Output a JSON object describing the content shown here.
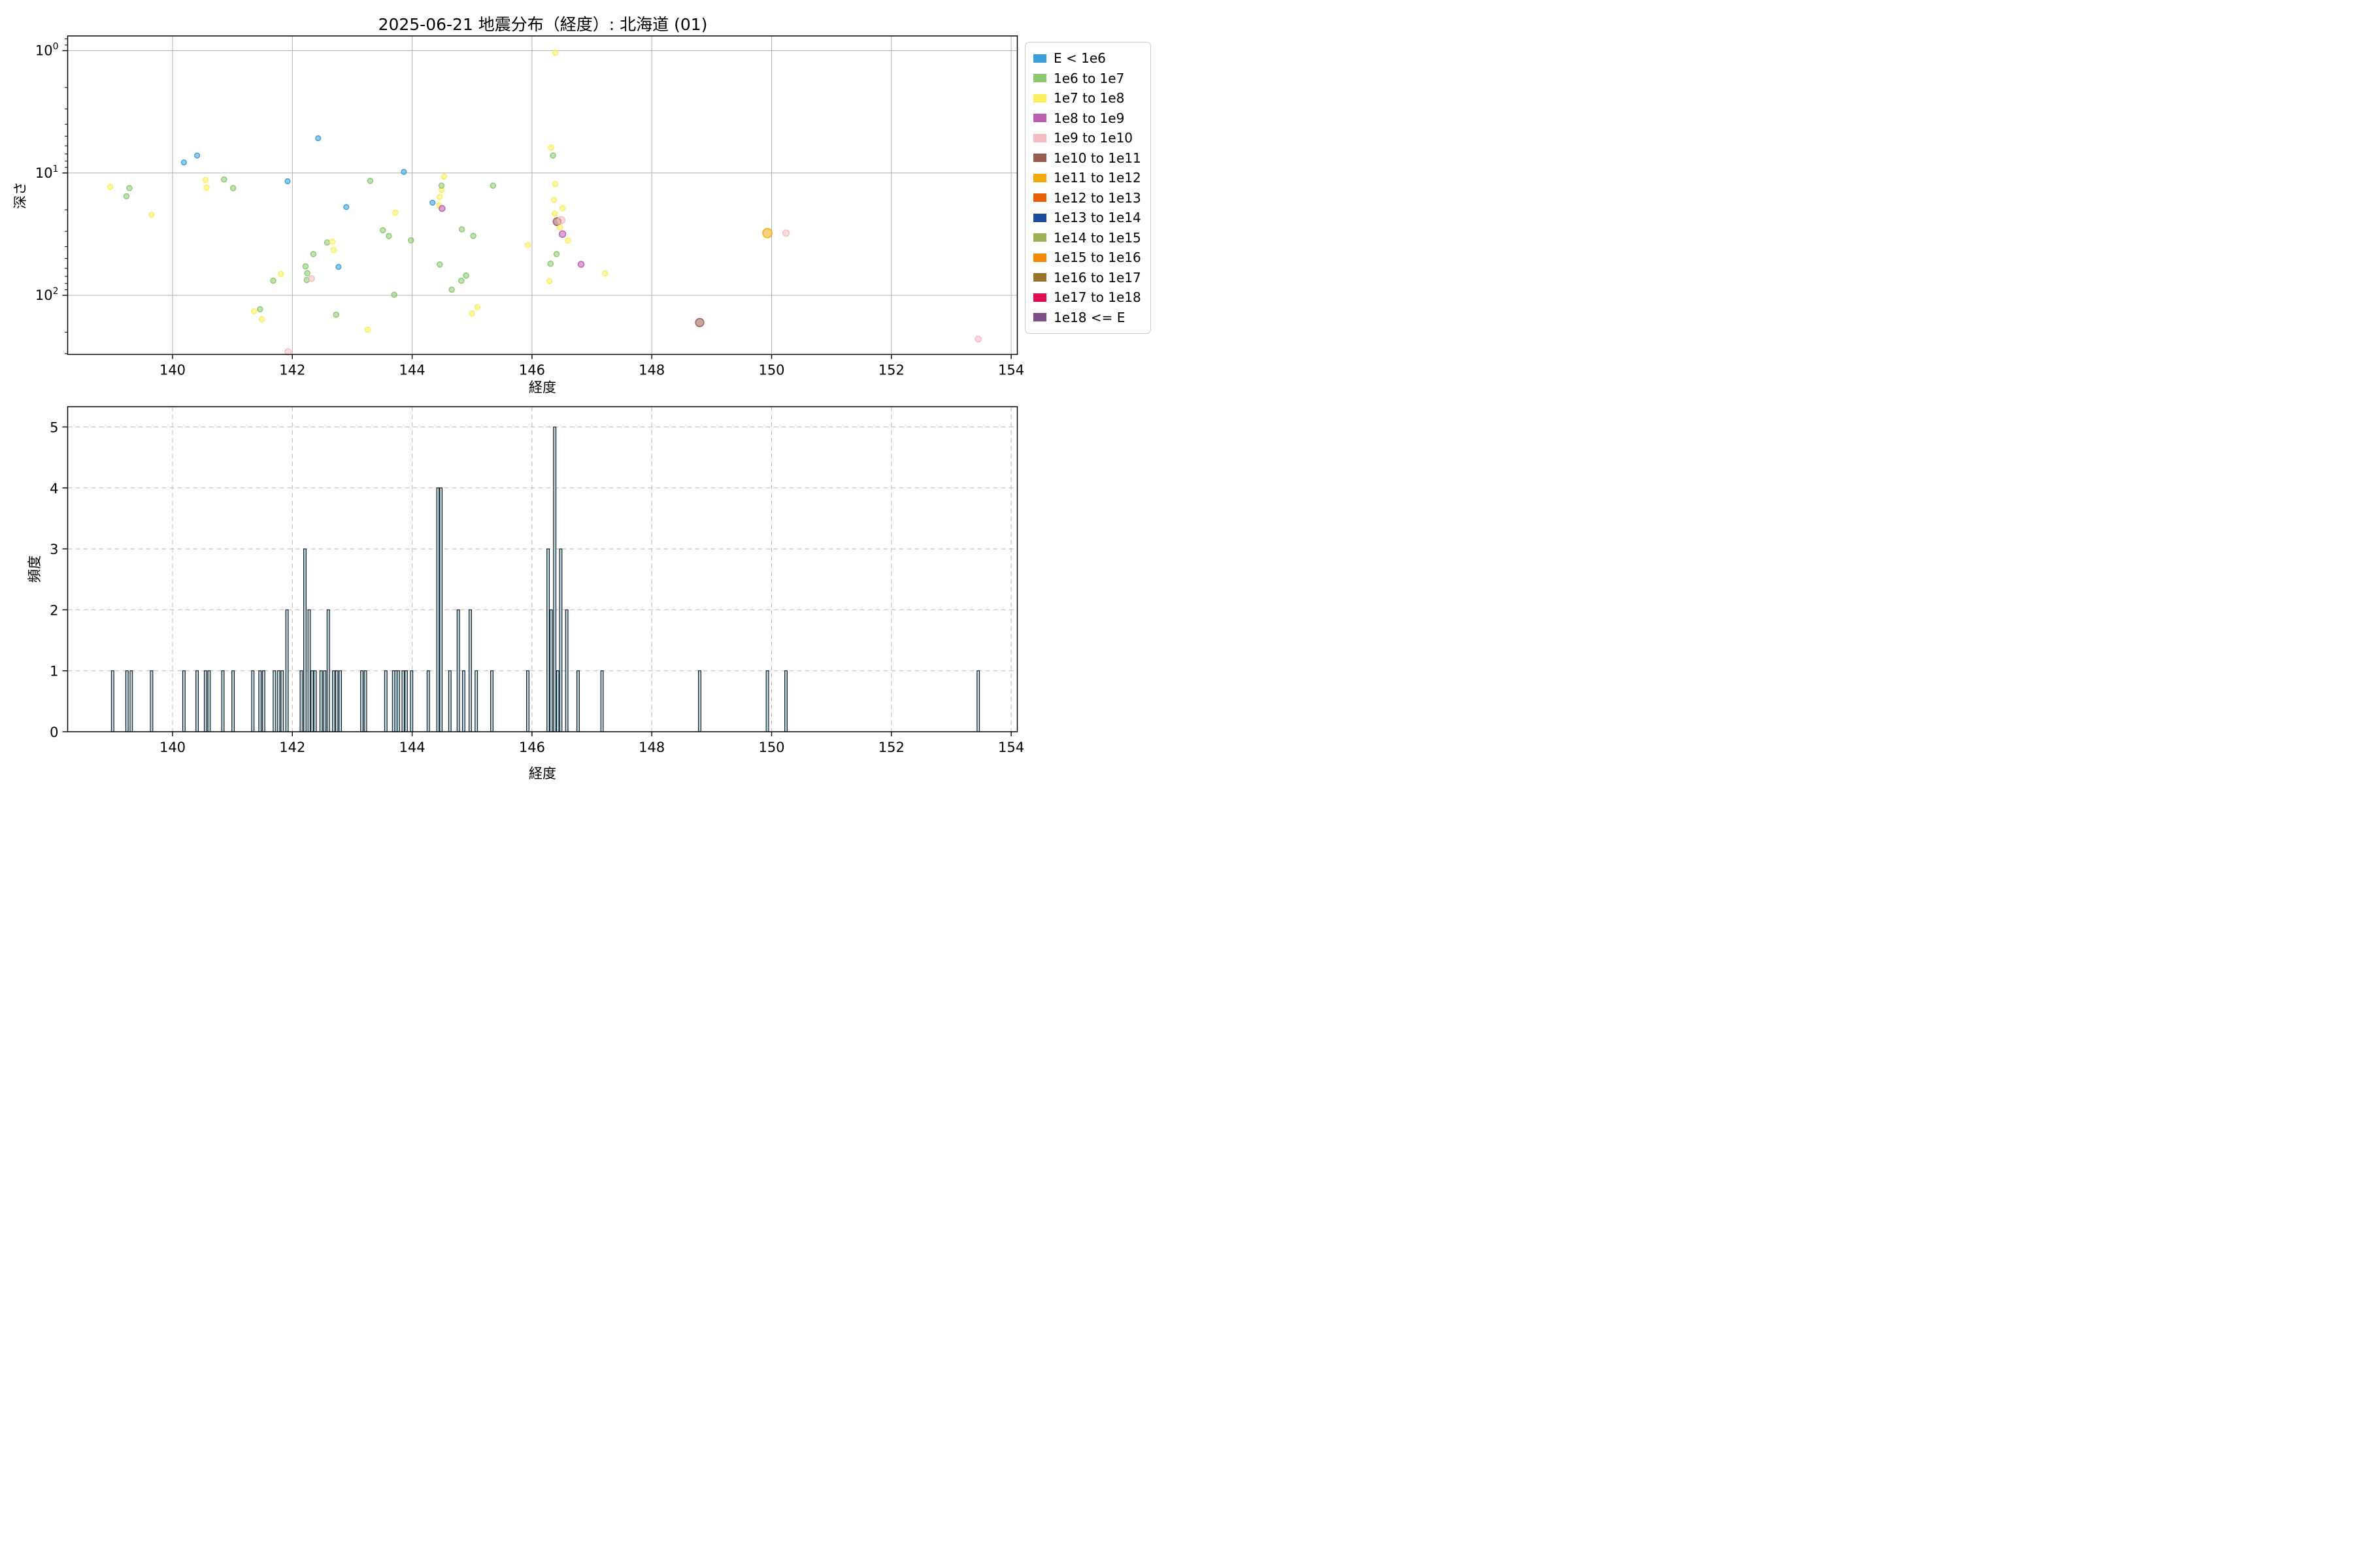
{
  "title": "2025-06-21 地震分布（経度）: 北海道 (01)",
  "legend": {
    "entries": [
      {
        "label": "E < 1e6",
        "color": "#3A9ED9"
      },
      {
        "label": "1e6 to 1e7",
        "color": "#8CC872"
      },
      {
        "label": "1e7 to 1e8",
        "color": "#FBEE5C"
      },
      {
        "label": "1e8 to 1e9",
        "color": "#BB5DB0"
      },
      {
        "label": "1e9 to 1e10",
        "color": "#F5BDC1"
      },
      {
        "label": "1e10 to 1e11",
        "color": "#9A5B50"
      },
      {
        "label": "1e11 to 1e12",
        "color": "#F3A90A"
      },
      {
        "label": "1e12 to 1e13",
        "color": "#E85F04"
      },
      {
        "label": "1e13 to 1e14",
        "color": "#1D4B9B"
      },
      {
        "label": "1e14 to 1e15",
        "color": "#9CB152"
      },
      {
        "label": "1e15 to 1e16",
        "color": "#F28900"
      },
      {
        "label": "1e16 to 1e17",
        "color": "#987329"
      },
      {
        "label": "1e17 to 1e18",
        "color": "#E20C50"
      },
      {
        "label": "1e18 <= E",
        "color": "#7D4E88"
      }
    ]
  },
  "chart_data": [
    {
      "type": "scatter",
      "title": "2025-06-21 地震分布（経度）: 北海道 (01)",
      "xlabel": "経度",
      "ylabel": "深さ",
      "xlim": [
        138.25,
        154.1
      ],
      "x_ticks": [
        140,
        142,
        144,
        146,
        148,
        150,
        152,
        154
      ],
      "y_scale": "log inverted (depth km)",
      "y_ticks": [
        1,
        10,
        100
      ],
      "ylim": [
        0.76,
        307
      ],
      "grid": "solid major",
      "legend_position": "outside upper right",
      "points": [
        {
          "lon": 138.96,
          "depth": 13,
          "cat": 2,
          "r": 4
        },
        {
          "lon": 139.23,
          "depth": 15.5,
          "cat": 1,
          "r": 4
        },
        {
          "lon": 139.28,
          "depth": 13.3,
          "cat": 1,
          "r": 4
        },
        {
          "lon": 139.65,
          "depth": 22,
          "cat": 2,
          "r": 4
        },
        {
          "lon": 140.19,
          "depth": 8.2,
          "cat": 0,
          "r": 3.8
        },
        {
          "lon": 140.41,
          "depth": 7.2,
          "cat": 0,
          "r": 3.8
        },
        {
          "lon": 140.55,
          "depth": 11.4,
          "cat": 2,
          "r": 4
        },
        {
          "lon": 140.57,
          "depth": 13.2,
          "cat": 2,
          "r": 4
        },
        {
          "lon": 140.86,
          "depth": 11.3,
          "cat": 1,
          "r": 4
        },
        {
          "lon": 141.01,
          "depth": 13.3,
          "cat": 1,
          "r": 4
        },
        {
          "lon": 141.36,
          "depth": 135,
          "cat": 2,
          "r": 4
        },
        {
          "lon": 141.46,
          "depth": 130,
          "cat": 1,
          "r": 4
        },
        {
          "lon": 141.49,
          "depth": 157,
          "cat": 2,
          "r": 4
        },
        {
          "lon": 141.68,
          "depth": 76,
          "cat": 1,
          "r": 4
        },
        {
          "lon": 141.81,
          "depth": 67,
          "cat": 2,
          "r": 4
        },
        {
          "lon": 141.92,
          "depth": 11.7,
          "cat": 0,
          "r": 3.8
        },
        {
          "lon": 141.93,
          "depth": 290,
          "cat": 4,
          "r": 4.8
        },
        {
          "lon": 142.22,
          "depth": 58,
          "cat": 1,
          "r": 4
        },
        {
          "lon": 142.25,
          "depth": 66,
          "cat": 1,
          "r": 4
        },
        {
          "lon": 142.24,
          "depth": 75,
          "cat": 1,
          "r": 4
        },
        {
          "lon": 142.32,
          "depth": 73,
          "cat": 4,
          "r": 4.5
        },
        {
          "lon": 142.35,
          "depth": 46,
          "cat": 1,
          "r": 4
        },
        {
          "lon": 142.43,
          "depth": 5.2,
          "cat": 0,
          "r": 3.8
        },
        {
          "lon": 142.58,
          "depth": 37,
          "cat": 1,
          "r": 4
        },
        {
          "lon": 142.67,
          "depth": 36.5,
          "cat": 2,
          "r": 4
        },
        {
          "lon": 142.69,
          "depth": 42.6,
          "cat": 2,
          "r": 4
        },
        {
          "lon": 142.77,
          "depth": 58.6,
          "cat": 0,
          "r": 3.8
        },
        {
          "lon": 142.73,
          "depth": 144,
          "cat": 1,
          "r": 4
        },
        {
          "lon": 142.9,
          "depth": 19,
          "cat": 0,
          "r": 3.8
        },
        {
          "lon": 143.26,
          "depth": 191,
          "cat": 2,
          "r": 4
        },
        {
          "lon": 143.3,
          "depth": 11.6,
          "cat": 1,
          "r": 4
        },
        {
          "lon": 143.51,
          "depth": 29.4,
          "cat": 1,
          "r": 4
        },
        {
          "lon": 143.61,
          "depth": 32.8,
          "cat": 1,
          "r": 4
        },
        {
          "lon": 143.7,
          "depth": 99,
          "cat": 1,
          "r": 4
        },
        {
          "lon": 143.72,
          "depth": 21.1,
          "cat": 2,
          "r": 4
        },
        {
          "lon": 143.86,
          "depth": 9.8,
          "cat": 0,
          "r": 3.8
        },
        {
          "lon": 143.98,
          "depth": 35.5,
          "cat": 1,
          "r": 4
        },
        {
          "lon": 144.34,
          "depth": 17.5,
          "cat": 0,
          "r": 3.8
        },
        {
          "lon": 144.45,
          "depth": 18.4,
          "cat": 2,
          "r": 4
        },
        {
          "lon": 144.46,
          "depth": 15.7,
          "cat": 2,
          "r": 4
        },
        {
          "lon": 144.46,
          "depth": 56,
          "cat": 1,
          "r": 4
        },
        {
          "lon": 144.49,
          "depth": 13.7,
          "cat": 2,
          "r": 4
        },
        {
          "lon": 144.49,
          "depth": 12.7,
          "cat": 1,
          "r": 4
        },
        {
          "lon": 144.5,
          "depth": 19.5,
          "cat": 3,
          "r": 4.5
        },
        {
          "lon": 144.53,
          "depth": 10.7,
          "cat": 2,
          "r": 4
        },
        {
          "lon": 144.66,
          "depth": 90,
          "cat": 1,
          "r": 4
        },
        {
          "lon": 144.82,
          "depth": 76,
          "cat": 1,
          "r": 4
        },
        {
          "lon": 144.83,
          "depth": 28.9,
          "cat": 1,
          "r": 4
        },
        {
          "lon": 144.9,
          "depth": 69,
          "cat": 1,
          "r": 4
        },
        {
          "lon": 145.0,
          "depth": 141,
          "cat": 2,
          "r": 4
        },
        {
          "lon": 145.02,
          "depth": 32.7,
          "cat": 1,
          "r": 4
        },
        {
          "lon": 145.09,
          "depth": 125,
          "cat": 2,
          "r": 4
        },
        {
          "lon": 145.35,
          "depth": 12.7,
          "cat": 1,
          "r": 4
        },
        {
          "lon": 145.93,
          "depth": 38.8,
          "cat": 2,
          "r": 4
        },
        {
          "lon": 146.29,
          "depth": 76.6,
          "cat": 2,
          "r": 4
        },
        {
          "lon": 146.31,
          "depth": 55.2,
          "cat": 1,
          "r": 4
        },
        {
          "lon": 146.32,
          "depth": 6.2,
          "cat": 2,
          "r": 4
        },
        {
          "lon": 146.35,
          "depth": 7.2,
          "cat": 1,
          "r": 4
        },
        {
          "lon": 146.37,
          "depth": 16.6,
          "cat": 2,
          "r": 4
        },
        {
          "lon": 146.38,
          "depth": 21.5,
          "cat": 2,
          "r": 4
        },
        {
          "lon": 146.39,
          "depth": 1.04,
          "cat": 2,
          "r": 4
        },
        {
          "lon": 146.39,
          "depth": 12.3,
          "cat": 2,
          "r": 4
        },
        {
          "lon": 146.41,
          "depth": 46,
          "cat": 1,
          "r": 4
        },
        {
          "lon": 146.42,
          "depth": 25.0,
          "cat": 5,
          "r": 6
        },
        {
          "lon": 146.47,
          "depth": 27.9,
          "cat": 2,
          "r": 4
        },
        {
          "lon": 146.49,
          "depth": 24.3,
          "cat": 4,
          "r": 5.5
        },
        {
          "lon": 146.51,
          "depth": 19.4,
          "cat": 2,
          "r": 4
        },
        {
          "lon": 146.51,
          "depth": 31.6,
          "cat": 3,
          "r": 5
        },
        {
          "lon": 146.6,
          "depth": 35.6,
          "cat": 2,
          "r": 4
        },
        {
          "lon": 146.82,
          "depth": 55.8,
          "cat": 3,
          "r": 4.5
        },
        {
          "lon": 147.22,
          "depth": 66.3,
          "cat": 2,
          "r": 4
        },
        {
          "lon": 148.8,
          "depth": 167,
          "cat": 5,
          "r": 6.3
        },
        {
          "lon": 149.93,
          "depth": 31,
          "cat": 6,
          "r": 7
        },
        {
          "lon": 150.24,
          "depth": 31,
          "cat": 4,
          "r": 4.8
        },
        {
          "lon": 153.45,
          "depth": 228,
          "cat": 4,
          "r": 4.6
        }
      ]
    },
    {
      "type": "bar",
      "xlabel": "経度",
      "ylabel": "頻度",
      "xlim": [
        138.25,
        154.1
      ],
      "x_ticks": [
        140,
        142,
        144,
        146,
        148,
        150,
        152,
        154
      ],
      "y_ticks": [
        0,
        1,
        2,
        3,
        4,
        5
      ],
      "ylim": [
        0,
        5.33
      ],
      "grid": "dashed both axes",
      "bar_color": "#B5D6E5",
      "bar_edge_color": "#111111",
      "bars": [
        [
          139.0,
          1
        ],
        [
          139.24,
          1
        ],
        [
          139.31,
          1
        ],
        [
          139.65,
          1
        ],
        [
          140.19,
          1
        ],
        [
          140.41,
          1
        ],
        [
          140.55,
          1
        ],
        [
          140.61,
          1
        ],
        [
          140.84,
          1
        ],
        [
          141.01,
          1
        ],
        [
          141.34,
          1
        ],
        [
          141.46,
          1
        ],
        [
          141.52,
          1
        ],
        [
          141.7,
          1
        ],
        [
          141.77,
          1
        ],
        [
          141.83,
          1
        ],
        [
          141.91,
          2
        ],
        [
          142.15,
          1
        ],
        [
          142.21,
          3
        ],
        [
          142.28,
          2
        ],
        [
          142.33,
          1
        ],
        [
          142.38,
          1
        ],
        [
          142.48,
          1
        ],
        [
          142.54,
          1
        ],
        [
          142.6,
          2
        ],
        [
          142.69,
          1
        ],
        [
          142.74,
          1
        ],
        [
          142.8,
          1
        ],
        [
          143.16,
          1
        ],
        [
          143.22,
          1
        ],
        [
          143.56,
          1
        ],
        [
          143.69,
          1
        ],
        [
          143.73,
          1
        ],
        [
          143.77,
          1
        ],
        [
          143.85,
          1
        ],
        [
          143.9,
          1
        ],
        [
          143.99,
          1
        ],
        [
          144.27,
          1
        ],
        [
          144.43,
          4
        ],
        [
          144.48,
          4
        ],
        [
          144.63,
          1
        ],
        [
          144.77,
          2
        ],
        [
          144.86,
          1
        ],
        [
          144.97,
          2
        ],
        [
          145.07,
          1
        ],
        [
          145.33,
          1
        ],
        [
          145.93,
          1
        ],
        [
          146.27,
          3
        ],
        [
          146.32,
          2
        ],
        [
          146.38,
          5
        ],
        [
          146.43,
          1
        ],
        [
          146.48,
          3
        ],
        [
          146.58,
          2
        ],
        [
          146.77,
          1
        ],
        [
          147.17,
          1
        ],
        [
          148.8,
          1
        ],
        [
          149.93,
          1
        ],
        [
          150.24,
          1
        ],
        [
          153.45,
          1
        ]
      ]
    }
  ]
}
